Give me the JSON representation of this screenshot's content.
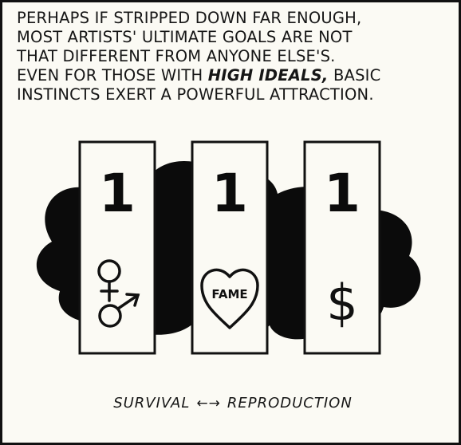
{
  "caption": {
    "line1": "PERHAPS IF STRIPPED DOWN FAR ENOUGH,",
    "line2": "MOST ARTISTS' ULTIMATE GOALS ARE NOT",
    "line3": "THAT DIFFERENT FROM ANYONE ELSE'S.",
    "line4_before": "EVEN FOR THOSE WITH ",
    "line4_emphasis": "HIGH IDEALS,",
    "line4_after": " BASIC",
    "line5": "INSTINCTS EXERT A POWERFUL ATTRACTION."
  },
  "slots": [
    {
      "number": "1",
      "icon": "gender-symbols-icon"
    },
    {
      "number": "1",
      "icon": "heart-icon",
      "label": "FAME"
    },
    {
      "number": "1",
      "icon": "dollar-sign-icon",
      "symbol": "$"
    }
  ],
  "footer": {
    "left": "SURVIVAL",
    "arrow": "←→",
    "right": "REPRODUCTION"
  },
  "colors": {
    "ink": "#111111",
    "paper": "#fbfaf4"
  }
}
